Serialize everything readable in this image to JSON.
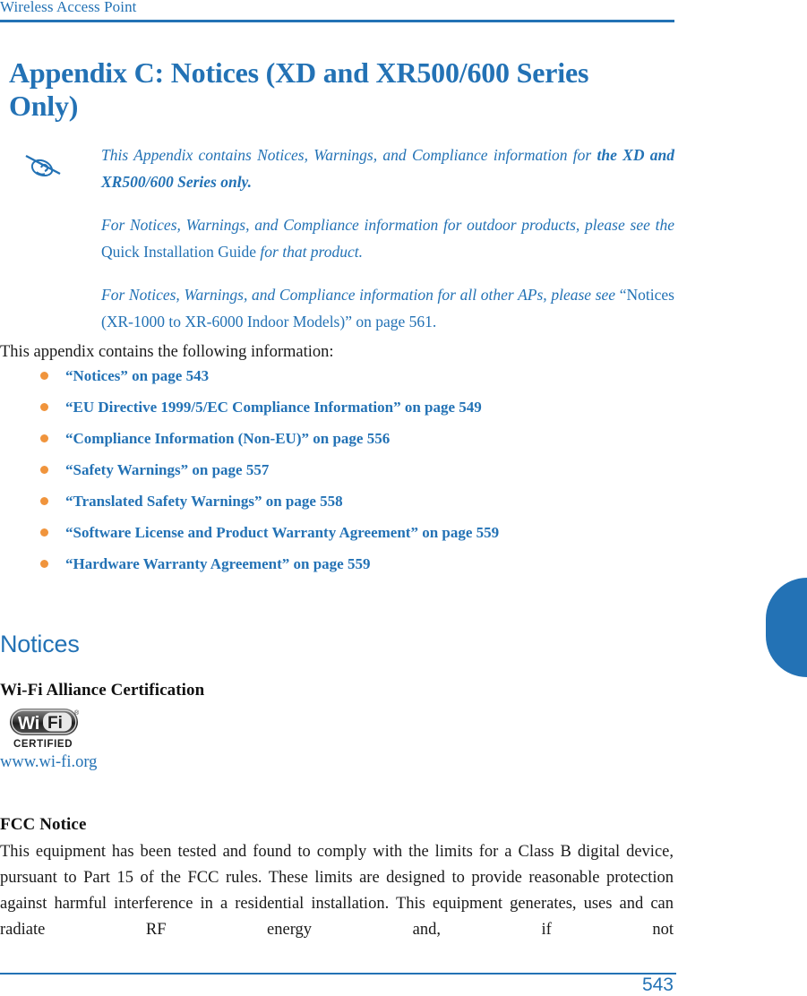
{
  "header": {
    "running_title": "Wireless Access Point",
    "rule_color": "#2372B5"
  },
  "title": {
    "text": "Appendix C: Notices (XD and XR500/600 Series Only)",
    "color": "#2372B5"
  },
  "note": {
    "icon": "note-pen-icon",
    "paragraph_1_lead": "This Appendix contains Notices, Warnings, and Compliance information for ",
    "paragraph_1_bold": "the XD and XR500/600 Series only.",
    "paragraph_2_lead": "For Notices, Warnings, and Compliance information for outdoor products, please see the ",
    "paragraph_2_upright": "Quick Installation Guide",
    "paragraph_2_tail": " for that product.",
    "paragraph_3_lead": "For Notices, Warnings, and Compliance information for all other APs, please see ",
    "paragraph_3_upright": "“Notices (XR-1000 to XR-6000 Indoor Models)” on page 561.",
    "color": "#2372B5"
  },
  "intro": {
    "text": "This appendix contains the following information:"
  },
  "bullets": {
    "dot_color": "#F0943C",
    "link_color": "#2372B5",
    "items": [
      {
        "label": "“Notices” on page 543"
      },
      {
        "label": "“EU Directive 1999/5/EC Compliance Information” on page 549"
      },
      {
        "label": "“Compliance Information (Non-EU)” on page 556"
      },
      {
        "label": "“Safety Warnings” on page 557"
      },
      {
        "label": "“Translated Safety Warnings” on page 558"
      },
      {
        "label": "“Software License and Product Warranty Agreement” on page 559"
      },
      {
        "label": "“Hardware Warranty Agreement” on page 559"
      }
    ]
  },
  "sections": {
    "notices_heading": "Notices",
    "wifi_subheading": "Wi-Fi Alliance Certification",
    "wifi_logo": {
      "primary_text": "Wi",
      "secondary_text": "Fi",
      "caption": "CERTIFIED",
      "registered_mark": "®"
    },
    "wifi_link": "www.wi-fi.org",
    "fcc_subheading": "FCC Notice",
    "fcc_body": "This equipment has been tested and found to comply with the limits for a Class B digital device, pursuant to Part 15 of the FCC rules. These limits are designed to provide reasonable protection against harmful interference in a residential installation. This equipment generates, uses and can radiate RF energy and, if not"
  },
  "thumb_tab": {
    "color": "#2372B5"
  },
  "footer": {
    "page_number": "543",
    "rule_color": "#2372B5"
  }
}
